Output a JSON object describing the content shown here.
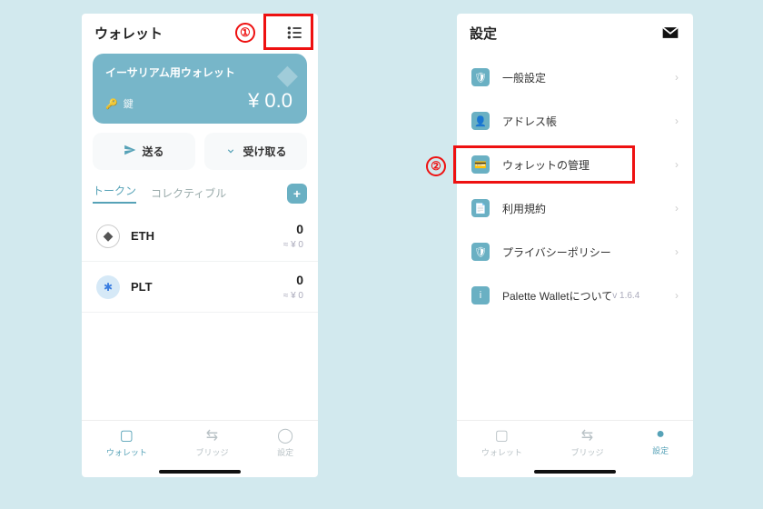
{
  "annotations": {
    "one": "①",
    "two": "②"
  },
  "left": {
    "header_title": "ウォレット",
    "card": {
      "wallet_name": "イーサリアム用ウォレット",
      "key_label": "鍵",
      "balance": "¥ 0.0"
    },
    "actions": {
      "send": "送る",
      "receive": "受け取る"
    },
    "tabs": {
      "tokens": "トークン",
      "collectibles": "コレクティブル"
    },
    "tokens": [
      {
        "symbol": "ETH",
        "amount": "0",
        "fiat": "≈ ¥ 0"
      },
      {
        "symbol": "PLT",
        "amount": "0",
        "fiat": "≈ ¥ 0"
      }
    ],
    "bottom_nav": {
      "wallet": "ウォレット",
      "bridge": "ブリッジ",
      "settings": "設定"
    }
  },
  "right": {
    "header_title": "設定",
    "rows": {
      "general": "一般設定",
      "address_book": "アドレス帳",
      "wallet_manage": "ウォレットの管理",
      "terms": "利用規約",
      "privacy": "プライバシーポリシー",
      "about": "Palette Walletについて",
      "version": "v 1.6.4"
    },
    "bottom_nav": {
      "wallet": "ウォレット",
      "bridge": "ブリッジ",
      "settings": "設定"
    }
  }
}
